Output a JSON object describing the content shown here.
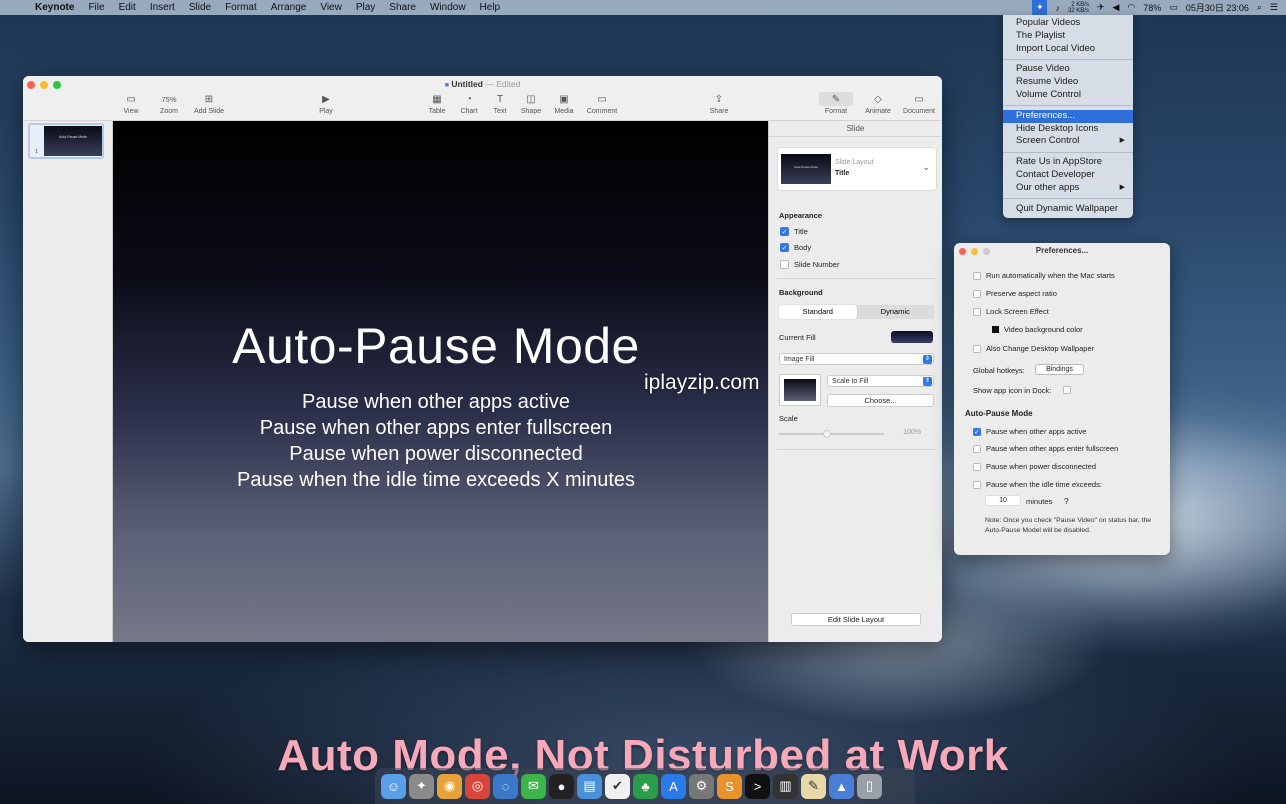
{
  "menubar": {
    "apple": "",
    "items": [
      "Keynote",
      "File",
      "Edit",
      "Insert",
      "Slide",
      "Format",
      "Arrange",
      "View",
      "Play",
      "Share",
      "Window",
      "Help"
    ],
    "net_up": "2 KB/s",
    "net_down": "32 KB/s",
    "battery": "78%",
    "datetime": "05月30日 23:06"
  },
  "dropdown": {
    "groups": [
      [
        "Popular Videos",
        "The Playlist",
        "Import Local Video"
      ],
      [
        "Pause Video",
        "Resume Video",
        "Volume Control"
      ],
      [
        "Preferences...",
        "Hide Desktop Icons",
        "Screen Control"
      ],
      [
        "Rate Us in AppStore",
        "Contact Developer",
        "Our other apps"
      ],
      [
        "Quit Dynamic Wallpaper"
      ]
    ],
    "active": "Preferences...",
    "submenu_arrow": "▶"
  },
  "keynote": {
    "title": "Untitled",
    "edited": "— Edited",
    "toolbar": {
      "view": "View",
      "zoom": "Zoom",
      "zoom_value": "75%",
      "add_slide": "Add Slide",
      "play": "Play",
      "table": "Table",
      "chart": "Chart",
      "text": "Text",
      "shape": "Shape",
      "media": "Media",
      "comment": "Comment",
      "share": "Share",
      "format": "Format",
      "animate": "Animate",
      "document": "Document"
    },
    "thumb_number": "1",
    "thumb_title": "Auto-Pause Mode",
    "slide": {
      "title": "Auto-Pause Mode",
      "body": [
        "Pause when other apps active",
        "Pause when other apps enter fullscreen",
        "Pause when power disconnected",
        "Pause when the idle time exceeds X minutes"
      ]
    },
    "inspector": {
      "tab": "Slide",
      "layout_label": "Slide Layout",
      "layout_value": "Title",
      "appearance": "Appearance",
      "title_chk": "Title",
      "body_chk": "Body",
      "slidenum_chk": "Slide Number",
      "background": "Background",
      "standard": "Standard",
      "dynamic": "Dynamic",
      "current_fill": "Current Fill",
      "image_fill": "Image Fill",
      "scale_to_fill": "Scale to Fill",
      "choose": "Choose...",
      "scale": "Scale",
      "scale_value": "100%",
      "edit_layout": "Edit Slide Layout"
    }
  },
  "prefs": {
    "title": "Preferences...",
    "run_auto": "Run automatically when the Mac starts",
    "aspect": "Preserve aspect ratio",
    "lock": "Lock Screen Effect",
    "video_bg": "Video background color",
    "change_desktop": "Also Change Desktop Wallpaper",
    "hotkeys": "Global hotkeys:",
    "bindings": "Bindings",
    "dock_icon": "Show app icon in Dock:",
    "auto_pause": "Auto-Pause Mode",
    "apps_active": "Pause when other apps active",
    "fullscreen": "Pause when other apps enter fullscreen",
    "power": "Pause when power disconnected",
    "idle": "Pause when the idle time exceeds:",
    "idle_value": "10",
    "minutes": "minutes",
    "help": "?",
    "note": "Note: Once you check \"Pause Video\" on status bar, the Auto-Pause Model will be disabled."
  },
  "watermark": "iplayzip.com",
  "caption": "Auto Mode, Not Disturbed at Work",
  "colors": {
    "accent": "#2f6fd9",
    "caption": "#f7a9ba"
  }
}
